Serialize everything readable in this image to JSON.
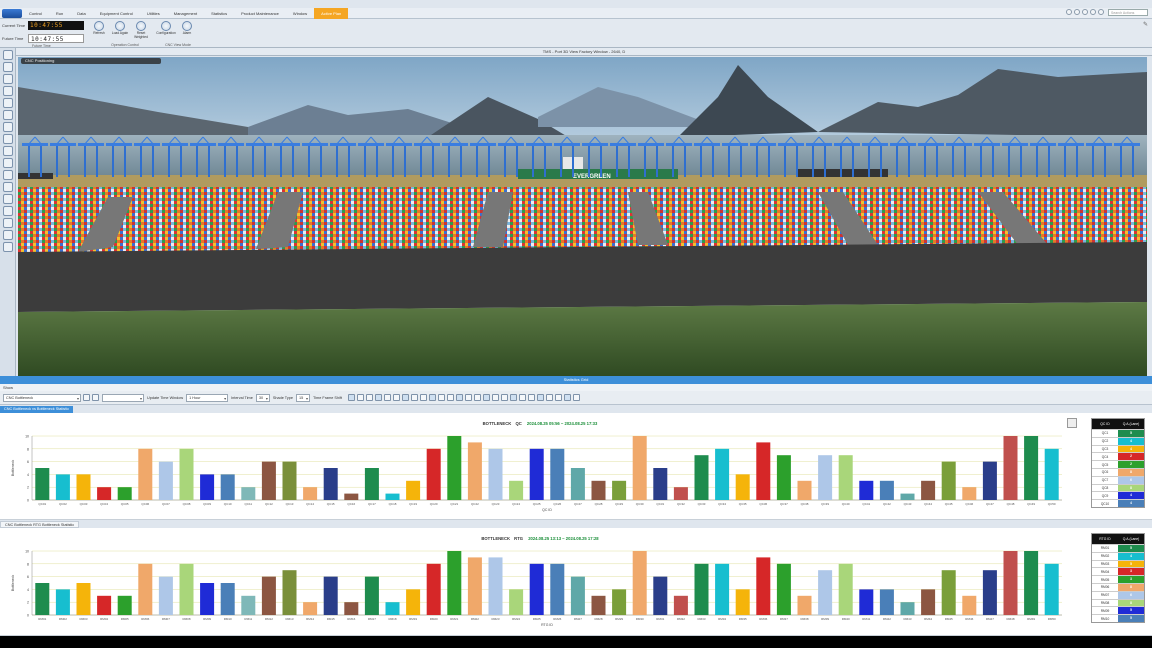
{
  "menu": [
    "Control",
    "Run",
    "Data",
    "Equipment Control",
    "Utilities",
    "Management",
    "Statistics",
    "Product Maintenance",
    "Window",
    "Active Plan"
  ],
  "search": {
    "placeholder": "Search Actions"
  },
  "time": {
    "current_label": "Current Time",
    "current_value": "10:47:55",
    "future_label": "Future Time",
    "future_value": "10:47:55"
  },
  "ribbon": {
    "group1": "Future Time",
    "buttons": [
      {
        "label": "Refresh"
      },
      {
        "label": "Load Again"
      },
      {
        "label": "Reset Weighted"
      },
      {
        "label": "Configuration"
      },
      {
        "label": "Alarm"
      }
    ],
    "group2": "Operation Control",
    "group3": "CNC View Mode"
  },
  "view": {
    "title": "TMS - Port 3D View Factory Window - 2640, D",
    "tag": "CNC Positioning",
    "vessel_name": "EVERGREEN"
  },
  "status_bar": "Statistics Grid",
  "panel_menu": "Show",
  "toolbar": {
    "layout": "CNC Bottleneck",
    "period_label": "Update Time Window",
    "period_value": "1 Hour",
    "interval_label": "Interval Time",
    "interval_value": "30",
    "shade_label": "Shade Type",
    "shade_value": "15",
    "shade_text": "Time Frame Shift"
  },
  "tabs": [
    "CNC Bottleneck vs Bottleneck Statistic",
    "CNC Bottleneck RTG Bottleneck Statistic"
  ],
  "colors": {
    "accent": "#3d8fd9",
    "dates": "#1c8f3a",
    "gridline": "#e0e0a0"
  },
  "chart_data": [
    {
      "type": "bar",
      "title": "BOTTLENECK",
      "subtitle": "QC",
      "dates": "2024.08.25 05:56 ~ 2024.08.25 17:33",
      "ylabel": "Bottleneck",
      "xlabel": "QC ID",
      "ylim": [
        0,
        10
      ],
      "yticks": [
        "0",
        "2",
        "4",
        "6",
        "8",
        "10"
      ],
      "categories": [
        "QC01",
        "QC02",
        "QC03",
        "QC04",
        "QC05",
        "QC06",
        "QC07",
        "QC08",
        "QC09",
        "QC10",
        "QC11",
        "QC12",
        "QC13",
        "QC14",
        "QC15",
        "QC16",
        "QC17",
        "QC18",
        "QC19",
        "QC20",
        "QC21",
        "QC22",
        "QC23",
        "QC24",
        "QC25",
        "QC26",
        "QC27",
        "QC28",
        "QC29",
        "QC30",
        "QC31",
        "QC32",
        "QC33",
        "QC34",
        "QC35",
        "QC36",
        "QC37",
        "QC38",
        "QC39",
        "QC40",
        "QC41",
        "QC42",
        "QC43",
        "QC44",
        "QC45",
        "QC46",
        "QC47",
        "QC48",
        "QC49",
        "QC50",
        "QC51"
      ],
      "values": [
        5,
        4,
        4,
        2,
        2,
        8,
        6,
        8,
        4,
        4,
        2,
        6,
        6,
        2,
        5,
        1,
        5,
        1,
        3,
        8,
        10,
        9,
        8,
        3,
        8,
        8,
        5,
        3,
        3,
        10,
        5,
        2,
        7,
        8,
        4,
        9,
        7,
        3,
        7,
        7,
        3,
        3,
        1,
        3,
        6,
        2,
        6,
        10,
        10,
        8
      ],
      "colors": [
        "#1e8c4e",
        "#17becf",
        "#f5b40a",
        "#d62728",
        "#2ca02c",
        "#f0a86a",
        "#aec7e8",
        "#a9d67a",
        "#1f2bd6",
        "#4a7fb8",
        "#7fb8b8",
        "#8c5642",
        "#7a8f3a",
        "#f0a86a",
        "#2a3e8a",
        "#8c5642",
        "#1e8c4e",
        "#17becf",
        "#f5b40a",
        "#d62728",
        "#2ca02c",
        "#f0a86a",
        "#aec7e8",
        "#a9d67a",
        "#1f2bd6",
        "#4a7fb8",
        "#5fa8a8",
        "#8c5642",
        "#7a9f3a",
        "#f0a86a",
        "#2a3e8a",
        "#c0504d",
        "#1e8c4e",
        "#17becf",
        "#f5b40a",
        "#d62728",
        "#2ca02c",
        "#f0a86a",
        "#aec7e8",
        "#a9d67a",
        "#1f2bd6",
        "#4a7fb8",
        "#5fa8a8",
        "#8c5642",
        "#7a9f3a",
        "#f0a86a",
        "#2a3e8a",
        "#c0504d",
        "#1e8c4e",
        "#17becf"
      ],
      "legend_header": [
        "QC ID",
        "Q.A.(Lane)"
      ],
      "legend": [
        {
          "k": "QC1",
          "v": "5",
          "c": "#1e8c4e"
        },
        {
          "k": "QC2",
          "v": "4",
          "c": "#17becf"
        },
        {
          "k": "QC3",
          "v": "4",
          "c": "#f5b40a"
        },
        {
          "k": "QC4",
          "v": "2",
          "c": "#d62728"
        },
        {
          "k": "QC5",
          "v": "2",
          "c": "#2ca02c"
        },
        {
          "k": "QC6",
          "v": "8",
          "c": "#f0a86a"
        },
        {
          "k": "QC7",
          "v": "6",
          "c": "#aec7e8"
        },
        {
          "k": "QC8",
          "v": "8",
          "c": "#a9d67a"
        },
        {
          "k": "QC9",
          "v": "4",
          "c": "#1f2bd6"
        },
        {
          "k": "QC10",
          "v": "4",
          "c": "#4a7fb8"
        }
      ]
    },
    {
      "type": "bar",
      "title": "BOTTLENECK",
      "subtitle": "RTG",
      "dates": "2024.08.25 13:13 ~ 2024.08.25 17:28",
      "ylabel": "Bottleneck",
      "xlabel": "RTG ID",
      "ylim": [
        0,
        10
      ],
      "yticks": [
        "0",
        "2",
        "4",
        "6",
        "8",
        "10"
      ],
      "categories": [
        "RM01",
        "RM02",
        "RM03",
        "RM04",
        "RM05",
        "RM06",
        "RM07",
        "RM08",
        "RM09",
        "RM10",
        "RM11",
        "RM12",
        "RM13",
        "RM14",
        "RM15",
        "RM16",
        "RM17",
        "RM18",
        "RM19",
        "RM20",
        "RM21",
        "RM22",
        "RM23",
        "RM24",
        "RM25",
        "RM26",
        "RM27",
        "RM28",
        "RM29",
        "RM30",
        "RM31",
        "RM32",
        "RM33",
        "RM34",
        "RM35",
        "RM36",
        "RM37",
        "RM38",
        "RM39",
        "RM40",
        "RM41",
        "RM42",
        "RM43",
        "RM44",
        "RM45",
        "RM46",
        "RM47",
        "RM48",
        "RM49",
        "RM50",
        "RM51"
      ],
      "values": [
        5,
        4,
        5,
        3,
        3,
        8,
        6,
        8,
        5,
        5,
        3,
        6,
        7,
        2,
        6,
        2,
        6,
        2,
        4,
        8,
        10,
        9,
        9,
        4,
        8,
        8,
        6,
        3,
        4,
        10,
        6,
        3,
        8,
        8,
        4,
        9,
        8,
        3,
        7,
        8,
        4,
        4,
        2,
        4,
        7,
        3,
        7,
        10,
        10,
        8
      ],
      "colors": [
        "#1e8c4e",
        "#17becf",
        "#f5b40a",
        "#d62728",
        "#2ca02c",
        "#f0a86a",
        "#aec7e8",
        "#a9d67a",
        "#1f2bd6",
        "#4a7fb8",
        "#7fb8b8",
        "#8c5642",
        "#7a8f3a",
        "#f0a86a",
        "#2a3e8a",
        "#8c5642",
        "#1e8c4e",
        "#17becf",
        "#f5b40a",
        "#d62728",
        "#2ca02c",
        "#f0a86a",
        "#aec7e8",
        "#a9d67a",
        "#1f2bd6",
        "#4a7fb8",
        "#5fa8a8",
        "#8c5642",
        "#7a9f3a",
        "#f0a86a",
        "#2a3e8a",
        "#c0504d",
        "#1e8c4e",
        "#17becf",
        "#f5b40a",
        "#d62728",
        "#2ca02c",
        "#f0a86a",
        "#aec7e8",
        "#a9d67a",
        "#1f2bd6",
        "#4a7fb8",
        "#5fa8a8",
        "#8c5642",
        "#7a9f3a",
        "#f0a86a",
        "#2a3e8a",
        "#c0504d",
        "#1e8c4e",
        "#17becf"
      ],
      "legend_header": [
        "RTG ID",
        "Q.A.(Lane)"
      ],
      "legend": [
        {
          "k": "RM01",
          "v": "5",
          "c": "#1e8c4e"
        },
        {
          "k": "RM02",
          "v": "4",
          "c": "#17becf"
        },
        {
          "k": "RM03",
          "v": "5",
          "c": "#f5b40a"
        },
        {
          "k": "RM04",
          "v": "3",
          "c": "#d62728"
        },
        {
          "k": "RM05",
          "v": "3",
          "c": "#2ca02c"
        },
        {
          "k": "RM06",
          "v": "8",
          "c": "#f0a86a"
        },
        {
          "k": "RM07",
          "v": "6",
          "c": "#aec7e8"
        },
        {
          "k": "RM08",
          "v": "8",
          "c": "#a9d67a"
        },
        {
          "k": "RM09",
          "v": "5",
          "c": "#1f2bd6"
        },
        {
          "k": "RM10",
          "v": "5",
          "c": "#4a7fb8"
        }
      ]
    }
  ]
}
